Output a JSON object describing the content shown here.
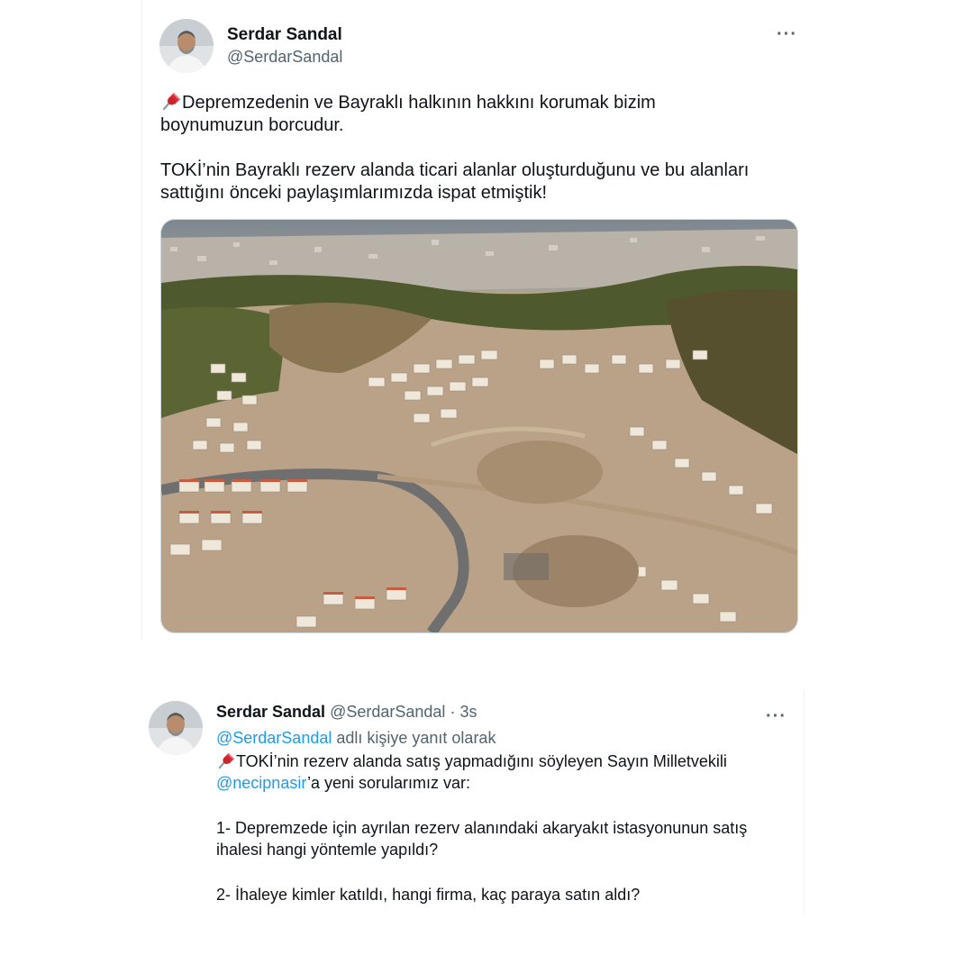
{
  "tweet1": {
    "author_name": "Serdar Sandal",
    "author_handle": "@SerdarSandal",
    "more_label": "···",
    "line1": "Depremzedenin ve Bayraklı halkının hakkını korumak bizim",
    "line2": "boynumuzun borcudur.",
    "line3": "TOKİ’nin Bayraklı rezerv alanda ticari alanlar oluşturduğunu ve bu alanları",
    "line4": "sattığını önceki paylaşımlarımızda ispat etmiştik!",
    "pin_icon": "pushpin-icon",
    "media_icon": "aerial-photo-housing-construction"
  },
  "tweet2": {
    "author_name": "Serdar Sandal",
    "author_handle": "@SerdarSandal",
    "separator": "·",
    "time": "3s",
    "more_label": "···",
    "reply_mention": "@SerdarSandal",
    "reply_suffix": " adlı kişiye yanıt olarak",
    "line1": "TOKİ’nin rezerv alanda satış yapmadığını söyleyen Sayın Milletvekili",
    "mention2": "@necipnasir",
    "line2_suffix": "’a yeni sorularımız var:",
    "q1_line1": "1- Depremzede için ayrılan rezerv alanındaki akaryakıt istasyonunun satış",
    "q1_line2": "ihalesi hangi yöntemle yapıldı?",
    "q2": "2- İhaleye kimler katıldı, hangi firma, kaç paraya satın aldı?",
    "pin_icon": "pushpin-icon"
  },
  "colors": {
    "link": "#1d9bf0",
    "muted": "#536471",
    "text": "#0f1419"
  }
}
